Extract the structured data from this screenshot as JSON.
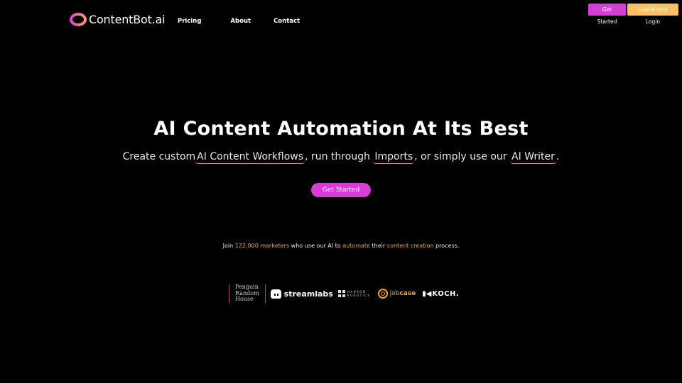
{
  "brand": {
    "name": "ContentBot.ai",
    "logo_icon": "gradient-ring-icon",
    "colors": {
      "primary": "#d63ed8",
      "secondary": "#ffc065",
      "highlight": "#e0a85a",
      "background": "#000000"
    }
  },
  "nav": {
    "links": [
      {
        "label": "Pricing"
      },
      {
        "label": "About"
      },
      {
        "label": "Contact"
      }
    ],
    "get_started_label": "Get Started",
    "dashboard_login_label": "Dashboard Login"
  },
  "hero": {
    "title": "AI Content Automation At Its Best",
    "subtitle": {
      "part1": "Create custom",
      "link1": "AI Content Workflows",
      "part2": ", run through ",
      "link2": "Imports",
      "part3": ", or simply use our ",
      "link3": "AI Writer",
      "part4": "."
    },
    "cta_label": "Get Started"
  },
  "social_proof": {
    "t1": "Join ",
    "h1": "122,000 marketers",
    "t2": " who use our AI to ",
    "h2": "automate",
    "t3": " their ",
    "h3": "content creation",
    "t4": " process."
  },
  "client_logos": {
    "penguin": {
      "line1": "Penguin",
      "line2": "Random",
      "line3": "House"
    },
    "streamlabs": "streamlabs",
    "hanson": {
      "line1": "HANSON",
      "line2": "ROBOTICS"
    },
    "jobcase": {
      "prefix": "job",
      "suffix": "case"
    },
    "koch": "KOCH."
  }
}
